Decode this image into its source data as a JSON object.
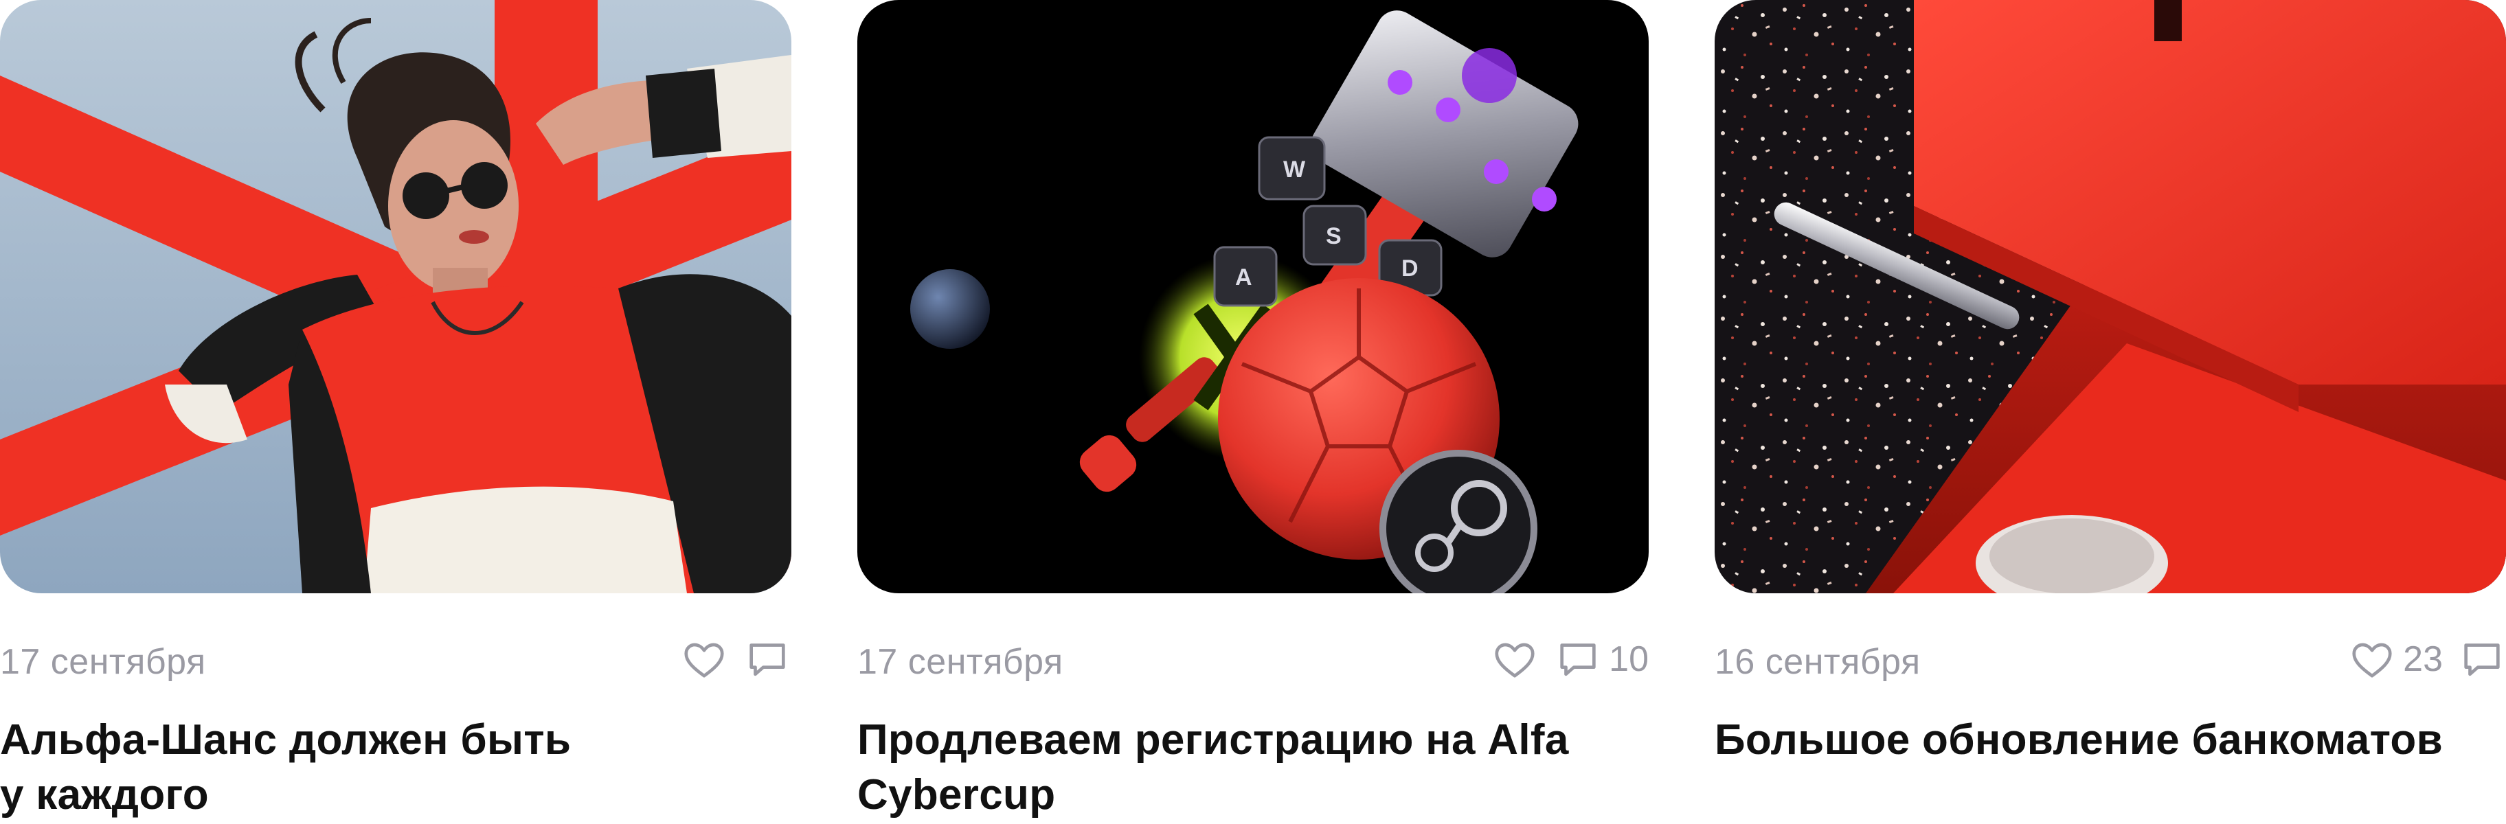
{
  "cards": [
    {
      "date": "17 сентября",
      "title_lines": [
        "Альфа-Шанс должен быть",
        "у каждого"
      ],
      "like_count": "",
      "comment_count": ""
    },
    {
      "date": "17 сентября",
      "title_lines": [
        "Продлеваем регистрацию на Alfa",
        "Cybercup"
      ],
      "like_count": "",
      "comment_count": "10"
    },
    {
      "date": "16 сентября",
      "title_lines": [
        "Большое обновление банкоматов"
      ],
      "like_count": "23",
      "comment_count": ""
    }
  ],
  "icons": {
    "like": "heart-icon",
    "comment": "comment-icon"
  },
  "colors": {
    "accent_red": "#ef3124",
    "text_dark": "#111111",
    "text_muted": "#9a9aa3"
  }
}
